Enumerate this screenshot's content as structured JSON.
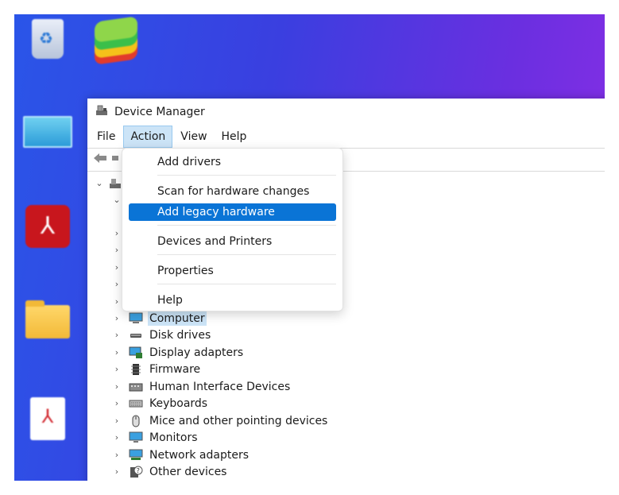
{
  "window": {
    "title": "Device Manager",
    "menus": [
      "File",
      "Action",
      "View",
      "Help"
    ],
    "active_menu": "Action"
  },
  "action_menu": {
    "items": [
      {
        "label": "Add drivers"
      },
      {
        "label": "Scan for hardware changes"
      },
      {
        "label": "Add legacy hardware",
        "highlighted": true
      },
      {
        "label": "Devices and Printers"
      },
      {
        "label": "Properties"
      },
      {
        "label": "Help"
      }
    ]
  },
  "device_tree": {
    "items": [
      {
        "label": "Computer",
        "icon": "computer-icon",
        "selected": true
      },
      {
        "label": "Disk drives",
        "icon": "disk-drive-icon"
      },
      {
        "label": "Display adapters",
        "icon": "display-adapter-icon"
      },
      {
        "label": "Firmware",
        "icon": "firmware-icon"
      },
      {
        "label": "Human Interface Devices",
        "icon": "hid-icon"
      },
      {
        "label": "Keyboards",
        "icon": "keyboard-icon"
      },
      {
        "label": "Mice and other pointing devices",
        "icon": "mouse-icon"
      },
      {
        "label": "Monitors",
        "icon": "monitor-icon"
      },
      {
        "label": "Network adapters",
        "icon": "network-adapter-icon"
      },
      {
        "label": "Other devices",
        "icon": "other-device-icon"
      }
    ]
  },
  "colors": {
    "highlight": "#0a74d6",
    "selection": "#cce4f7",
    "desktop_gradient_start": "#2a55e8",
    "desktop_gradient_end": "#8a2fe6"
  }
}
